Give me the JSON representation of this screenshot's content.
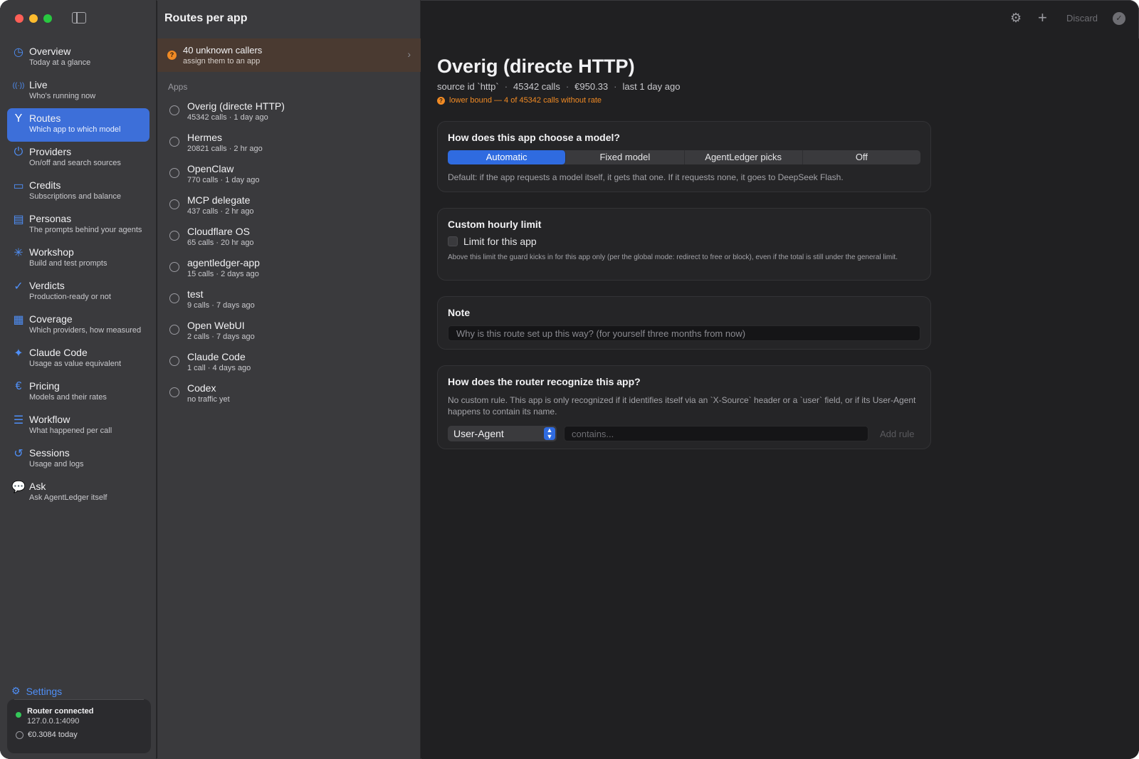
{
  "window": {
    "toolbar_title": "Routes per app",
    "discard_label": "Discard"
  },
  "sidebar": {
    "items": [
      {
        "label": "Overview",
        "sub": "Today at a glance",
        "icon": "gauge-icon",
        "glyph": "◷"
      },
      {
        "label": "Live",
        "sub": "Who's running now",
        "icon": "broadcast-icon",
        "glyph": "((·))"
      },
      {
        "label": "Routes",
        "sub": "Which app to which model",
        "icon": "fork-icon",
        "glyph": "Y",
        "active": true
      },
      {
        "label": "Providers",
        "sub": "On/off and search sources",
        "icon": "power-icon",
        "glyph": "⏻"
      },
      {
        "label": "Credits",
        "sub": "Subscriptions and balance",
        "icon": "credit-card-icon",
        "glyph": "▭"
      },
      {
        "label": "Personas",
        "sub": "The prompts behind your agents",
        "icon": "id-card-icon",
        "glyph": "▤"
      },
      {
        "label": "Workshop",
        "sub": "Build and test prompts",
        "icon": "sparkle-icon",
        "glyph": "✳"
      },
      {
        "label": "Verdicts",
        "sub": "Production-ready or not",
        "icon": "badge-check-icon",
        "glyph": "✓"
      },
      {
        "label": "Coverage",
        "sub": "Which providers, how measured",
        "icon": "document-icon",
        "glyph": "▦"
      },
      {
        "label": "Claude Code",
        "sub": "Usage as value equivalent",
        "icon": "spark-icon",
        "glyph": "✦"
      },
      {
        "label": "Pricing",
        "sub": "Models and their rates",
        "icon": "euro-icon",
        "glyph": "€"
      },
      {
        "label": "Workflow",
        "sub": "What happened per call",
        "icon": "list-window-icon",
        "glyph": "☰"
      },
      {
        "label": "Sessions",
        "sub": "Usage and logs",
        "icon": "history-icon",
        "glyph": "↺"
      },
      {
        "label": "Ask",
        "sub": "Ask AgentLedger itself",
        "icon": "chat-bubbles-icon",
        "glyph": "💬"
      }
    ],
    "settings_label": "Settings",
    "status": {
      "title": "Router connected",
      "address": "127.0.0.1:4090",
      "cost_today": "€0.3084 today"
    }
  },
  "list": {
    "unknown_title": "40 unknown callers",
    "unknown_sub": "assign them to an app",
    "apps_header": "Apps",
    "apps": [
      {
        "name": "Overig (directe HTTP)",
        "meta": "45342 calls  ·  1 day ago"
      },
      {
        "name": "Hermes",
        "meta": "20821 calls  ·  2 hr ago"
      },
      {
        "name": "OpenClaw",
        "meta": "770 calls  ·  1 day ago"
      },
      {
        "name": "MCP delegate",
        "meta": "437 calls  ·  2 hr ago"
      },
      {
        "name": "Cloudflare OS",
        "meta": "65 calls  ·  20 hr ago"
      },
      {
        "name": "agentledger-app",
        "meta": "15 calls  ·  2 days ago"
      },
      {
        "name": "test",
        "meta": "9 calls  ·  7 days ago"
      },
      {
        "name": "Open WebUI",
        "meta": "2 calls  ·  7 days ago"
      },
      {
        "name": "Claude Code",
        "meta": "1 call  ·  4 days ago"
      },
      {
        "name": "Codex",
        "meta": "no traffic yet"
      }
    ]
  },
  "detail": {
    "title": "Overig (directe HTTP)",
    "source_id": "source id `http`",
    "calls": "45342 calls",
    "cost": "€950.33",
    "last": "last 1 day ago",
    "lower_bound": "lower bound — 4 of 45342 calls without rate",
    "model_card": {
      "title": "How does this app choose a model?",
      "options": [
        "Automatic",
        "Fixed model",
        "AgentLedger picks",
        "Off"
      ],
      "selected": "Automatic",
      "description": "Default: if the app requests a model itself, it gets that one. If it requests none, it goes to DeepSeek Flash."
    },
    "limit_card": {
      "title": "Custom hourly limit",
      "checkbox_label": "Limit for this app",
      "checked": false,
      "description": "Above this limit the guard kicks in for this app only (per the global mode: redirect to free or block), even if the total is still under the general limit."
    },
    "note_card": {
      "title": "Note",
      "placeholder": "Why is this route set up this way? (for yourself three months from now)"
    },
    "router_card": {
      "title": "How does the router recognize this app?",
      "description": "No custom rule. This app is only recognized if it identifies itself via an `X-Source` header or a `user` field, or if its User-Agent happens to contain its name.",
      "select_value": "User-Agent",
      "contains_placeholder": "contains...",
      "add_rule_label": "Add rule"
    }
  },
  "colors": {
    "accent": "#2f6be0",
    "warning": "#f08a24",
    "connected": "#34c759"
  }
}
